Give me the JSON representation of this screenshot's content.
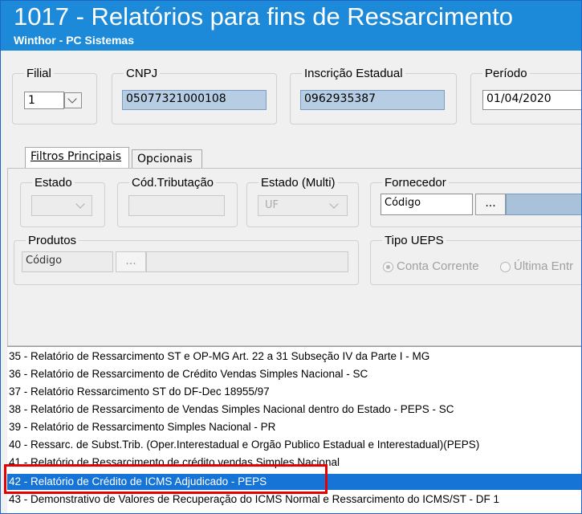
{
  "window": {
    "title": "1017 - Relatórios para fins de Ressarcimento",
    "subtitle": "Winthor - PC Sistemas"
  },
  "header": {
    "filial": {
      "label": "Filial",
      "value": "1"
    },
    "cnpj": {
      "label": "CNPJ",
      "value": "05077321000108"
    },
    "inscricao": {
      "label": "Inscrição Estadual",
      "value": "0962935387"
    },
    "periodo": {
      "label": "Período",
      "value": "01/04/2020"
    }
  },
  "tabs": [
    {
      "label": "Filtros Principais",
      "active": true
    },
    {
      "label": "Opcionais",
      "active": false
    }
  ],
  "filters": {
    "estado": {
      "label": "Estado"
    },
    "cod_tributacao": {
      "label": "Cód.Tributação"
    },
    "estado_multi": {
      "label": "Estado (Multi)",
      "value": "UF"
    },
    "fornecedor": {
      "label": "Fornecedor",
      "placeholder": "Código",
      "button": "..."
    },
    "produtos": {
      "label": "Produtos",
      "placeholder": "Código",
      "button": "..."
    },
    "tipo_ueps": {
      "label": "Tipo UEPS",
      "options": [
        "Conta Corrente",
        "Última Entr"
      ]
    }
  },
  "reports": [
    "35 - Relatório de Ressarcimento ST e OP-MG Art. 22 a 31 Subseção IV da Parte I - MG",
    "36 - Relatório de Ressarcimento de Crédito Vendas Simples Nacional - SC",
    "37 - Relatório Ressarcimento ST do DF-Dec 18955/97",
    "38 - Relatório de Ressarcimento de Vendas Simples Nacional dentro do Estado - PEPS - SC",
    "39 - Relatório de Ressarcimento Simples Nacional - PR",
    "40 - Ressarc. de Subst.Trib. (Oper.Interestadual e Orgão Publico Estadual e Interestadual)(PEPS)",
    "41 - Relatório de Ressarcimento de crédito vendas Simples Nacional",
    "42 - Relatório de Crédito de ICMS Adjudicado - PEPS",
    "43 - Demonstrativo de Valores de Recuperação do ICMS Normal e Ressarcimento do ICMS/ST - DF 1"
  ],
  "selected_report_index": 7,
  "colors": {
    "title_bar": "#1c8ad8",
    "selection": "#1674d7",
    "highlight": "#e60000",
    "readonly": "#b6cde3"
  }
}
